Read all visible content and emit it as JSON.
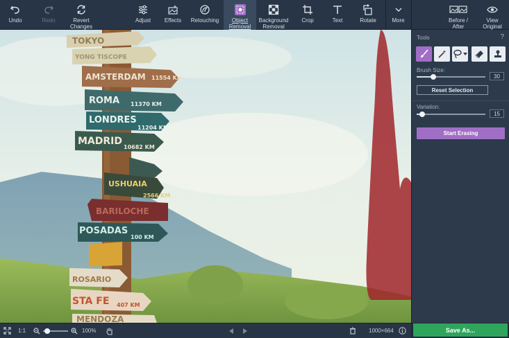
{
  "toolbar": {
    "undo": "Undo",
    "redo": "Redo",
    "revert_line1": "Revert",
    "revert_line2": "Changes",
    "adjust": "Adjust",
    "effects": "Effects",
    "retouching": "Retouching",
    "object_removal_line1": "Object",
    "object_removal_line2": "Removal",
    "background_removal_line1": "Background",
    "background_removal_line2": "Removal",
    "crop": "Crop",
    "text": "Text",
    "rotate": "Rotate",
    "more": "More",
    "before_after_line1": "Before /",
    "before_after_line2": "After",
    "view_original_line1": "View",
    "view_original_line2": "Original"
  },
  "panel": {
    "title": "Tools",
    "help": "?",
    "brush_size_label": "Brush Size:",
    "brush_size_value": "30",
    "brush_size_fraction": 0.24,
    "reset_selection": "Reset Selection",
    "variation_label": "Variation:",
    "variation_value": "15",
    "variation_fraction": 0.08,
    "start_erasing": "Start Erasing"
  },
  "signs": [
    "TOKYO",
    "YONG TISCOPE",
    "AMSTERDAM",
    "11554 KM",
    "ROMA",
    "11370 KM",
    "LONDRES",
    "11204 KM",
    "MADRID",
    "10682 KM",
    "USHUAIA",
    "2566 KM",
    "BARILOCHE",
    "POSADAS",
    "100 KM",
    "ROSARIO",
    "STA FE",
    "407 KM",
    "MENDOZA"
  ],
  "bottom": {
    "ratio": "1:1",
    "zoom": "100%",
    "zoom_fraction": 0.1,
    "dimensions": "1000×664",
    "save_as": "Save As..."
  },
  "colors": {
    "accent_purple": "#a06fc5",
    "save_green": "#2fa55b",
    "toolbar_bg": "#283546",
    "panel_bg": "#2c3a4c",
    "selection_red": "#a0262a"
  }
}
